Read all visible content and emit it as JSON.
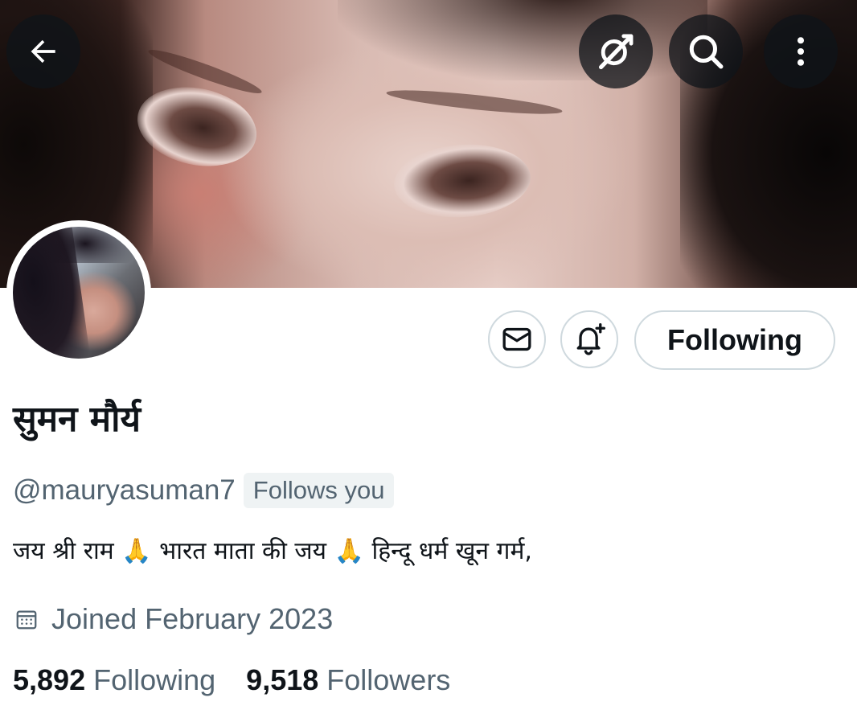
{
  "header": {
    "back_icon": "arrow-left-icon",
    "grok_icon": "grok-icon",
    "search_icon": "search-icon",
    "more_icon": "more-vertical-icon"
  },
  "actions": {
    "message_icon": "envelope-icon",
    "notify_icon": "bell-plus-icon",
    "following_label": "Following"
  },
  "profile": {
    "display_name": "सुमन मौर्य",
    "handle": "@mauryasuman7",
    "follows_you": "Follows you",
    "bio": "जय श्री राम 🙏 भारत माता की जय 🙏 हिन्दू धर्म खून गर्म,",
    "joined": "Joined February 2023",
    "joined_icon": "calendar-icon"
  },
  "stats": {
    "following_count": "5,892",
    "following_label": "Following",
    "followers_count": "9,518",
    "followers_label": "Followers"
  },
  "colors": {
    "text_primary": "#0f1419",
    "text_secondary": "#536471",
    "border": "#cfd9de",
    "badge_bg": "#eff3f4"
  }
}
